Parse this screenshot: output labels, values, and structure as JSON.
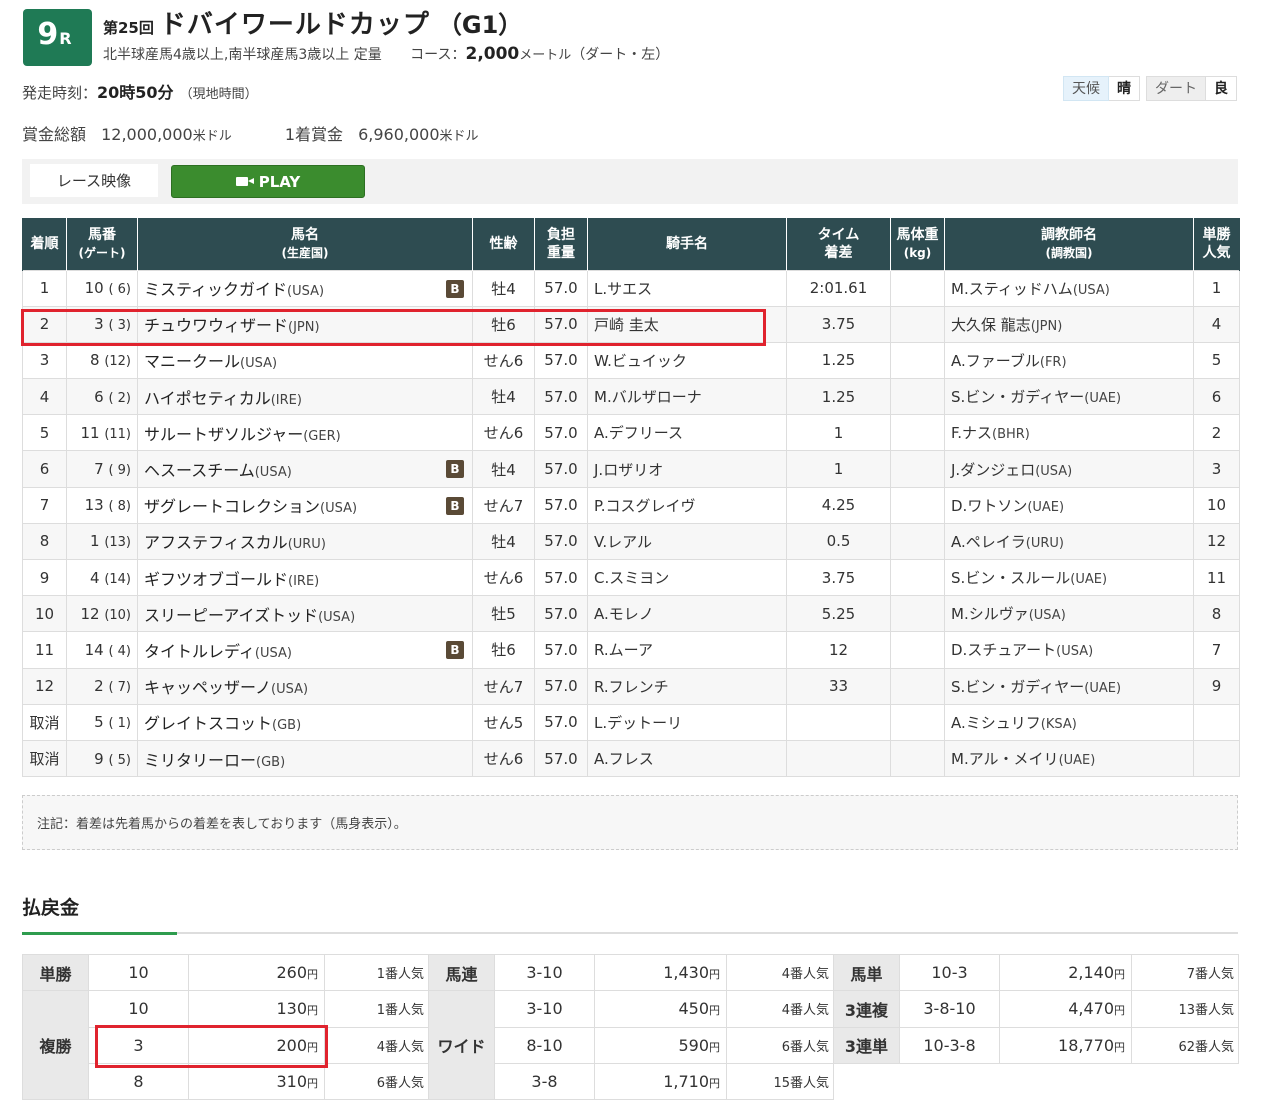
{
  "race": {
    "number": "9",
    "r_label": "R",
    "round": "第25回",
    "name": "ドバイワールドカップ",
    "grade": "（G1）",
    "conditions": "北半球産馬4歳以上,南半球産馬3歳以上 定量",
    "course_label": "コース：",
    "distance": "2,000",
    "distance_unit": "メートル",
    "surface": "（ダート・左）",
    "start_label": "発走時刻：",
    "start_time": "20時50分",
    "start_local": "（現地時間）"
  },
  "conditions_box": {
    "weather_label": "天候",
    "weather": "晴",
    "track_label": "ダート",
    "track": "良"
  },
  "prize": {
    "total_label": "賞金総額",
    "total": "12,000,000",
    "total_unit": "米ドル",
    "first_label": "1着賞金",
    "first": "6,960,000",
    "first_unit": "米ドル"
  },
  "video": {
    "tab_label": "レース映像",
    "play_label": "PLAY"
  },
  "results_header": {
    "pos": "着順",
    "num": "馬番",
    "num_sub": "(ゲート)",
    "horse": "馬名",
    "horse_sub": "(生産国)",
    "sexage": "性齢",
    "weight": "負担",
    "weight_sub": "重量",
    "jockey": "騎手名",
    "time": "タイム",
    "time_sub": "着差",
    "bodyweight": "馬体重",
    "bodyweight_sub": "(kg)",
    "trainer": "調教師名",
    "trainer_sub": "(調教国)",
    "fav": "単勝",
    "fav_sub": "人気"
  },
  "results": [
    {
      "pos": "1",
      "num": "10",
      "gate": "( 6)",
      "horse": "ミスティックガイド",
      "country": "(USA)",
      "blinker": "B",
      "sexage": "牡4",
      "weight": "57.0",
      "jockey": "L.サエス",
      "time": "2:01.61",
      "body": "",
      "trainer": "M.スティッドハム",
      "trainer_country": "(USA)",
      "fav": "1"
    },
    {
      "pos": "2",
      "num": "3",
      "gate": "( 3)",
      "horse": "チュウワウィザード",
      "country": "(JPN)",
      "blinker": "",
      "sexage": "牡6",
      "weight": "57.0",
      "jockey": "戸崎 圭太",
      "time": "3.75",
      "body": "",
      "trainer": "大久保 龍志",
      "trainer_country": "(JPN)",
      "fav": "4"
    },
    {
      "pos": "3",
      "num": "8",
      "gate": "(12)",
      "horse": "マニークール",
      "country": "(USA)",
      "blinker": "",
      "sexage": "せん6",
      "weight": "57.0",
      "jockey": "W.ビュイック",
      "time": "1.25",
      "body": "",
      "trainer": "A.ファーブル",
      "trainer_country": "(FR)",
      "fav": "5"
    },
    {
      "pos": "4",
      "num": "6",
      "gate": "( 2)",
      "horse": "ハイポセティカル",
      "country": "(IRE)",
      "blinker": "",
      "sexage": "牡4",
      "weight": "57.0",
      "jockey": "M.バルザローナ",
      "time": "1.25",
      "body": "",
      "trainer": "S.ビン・ガディヤー",
      "trainer_country": "(UAE)",
      "fav": "6"
    },
    {
      "pos": "5",
      "num": "11",
      "gate": "(11)",
      "horse": "サルートザソルジャー",
      "country": "(GER)",
      "blinker": "",
      "sexage": "せん6",
      "weight": "57.0",
      "jockey": "A.デフリース",
      "time": "1",
      "body": "",
      "trainer": "F.ナス",
      "trainer_country": "(BHR)",
      "fav": "2"
    },
    {
      "pos": "6",
      "num": "7",
      "gate": "( 9)",
      "horse": "ヘスースチーム",
      "country": "(USA)",
      "blinker": "B",
      "sexage": "牡4",
      "weight": "57.0",
      "jockey": "J.ロザリオ",
      "time": "1",
      "body": "",
      "trainer": "J.ダンジェロ",
      "trainer_country": "(USA)",
      "fav": "3"
    },
    {
      "pos": "7",
      "num": "13",
      "gate": "( 8)",
      "horse": "ザグレートコレクション",
      "country": "(USA)",
      "blinker": "B",
      "sexage": "せん7",
      "weight": "57.0",
      "jockey": "P.コスグレイヴ",
      "time": "4.25",
      "body": "",
      "trainer": "D.ワトソン",
      "trainer_country": "(UAE)",
      "fav": "10"
    },
    {
      "pos": "8",
      "num": "1",
      "gate": "(13)",
      "horse": "アフステフィスカル",
      "country": "(URU)",
      "blinker": "",
      "sexage": "牡4",
      "weight": "57.0",
      "jockey": "V.レアル",
      "time": "0.5",
      "body": "",
      "trainer": "A.ペレイラ",
      "trainer_country": "(URU)",
      "fav": "12"
    },
    {
      "pos": "9",
      "num": "4",
      "gate": "(14)",
      "horse": "ギフツオブゴールド",
      "country": "(IRE)",
      "blinker": "",
      "sexage": "せん6",
      "weight": "57.0",
      "jockey": "C.スミヨン",
      "time": "3.75",
      "body": "",
      "trainer": "S.ビン・スルール",
      "trainer_country": "(UAE)",
      "fav": "11"
    },
    {
      "pos": "10",
      "num": "12",
      "gate": "(10)",
      "horse": "スリーピーアイズトッド",
      "country": "(USA)",
      "blinker": "",
      "sexage": "牡5",
      "weight": "57.0",
      "jockey": "A.モレノ",
      "time": "5.25",
      "body": "",
      "trainer": "M.シルヴァ",
      "trainer_country": "(USA)",
      "fav": "8"
    },
    {
      "pos": "11",
      "num": "14",
      "gate": "( 4)",
      "horse": "タイトルレディ",
      "country": "(USA)",
      "blinker": "B",
      "sexage": "牡6",
      "weight": "57.0",
      "jockey": "R.ムーア",
      "time": "12",
      "body": "",
      "trainer": "D.スチュアート",
      "trainer_country": "(USA)",
      "fav": "7"
    },
    {
      "pos": "12",
      "num": "2",
      "gate": "( 7)",
      "horse": "キャッペッザーノ",
      "country": "(USA)",
      "blinker": "",
      "sexage": "せん7",
      "weight": "57.0",
      "jockey": "R.フレンチ",
      "time": "33",
      "body": "",
      "trainer": "S.ビン・ガディヤー",
      "trainer_country": "(UAE)",
      "fav": "9"
    },
    {
      "pos": "取消",
      "num": "5",
      "gate": "( 1)",
      "horse": "グレイトスコット",
      "country": "(GB)",
      "blinker": "",
      "sexage": "せん5",
      "weight": "57.0",
      "jockey": "L.デットーリ",
      "time": "",
      "body": "",
      "trainer": "A.ミシュリフ",
      "trainer_country": "(KSA)",
      "fav": ""
    },
    {
      "pos": "取消",
      "num": "9",
      "gate": "( 5)",
      "horse": "ミリタリーロー",
      "country": "(GB)",
      "blinker": "",
      "sexage": "せん6",
      "weight": "57.0",
      "jockey": "A.フレス",
      "time": "",
      "body": "",
      "trainer": "M.アル・メイリ",
      "trainer_country": "(UAE)",
      "fav": ""
    }
  ],
  "note": "注記：着差は先着馬からの着差を表しております（馬身表示）。",
  "payout": {
    "title": "払戻金",
    "yen_unit": "円",
    "win": {
      "label": "単勝",
      "rows": [
        {
          "num": "10",
          "amount": "260",
          "pop": "1番人気"
        }
      ]
    },
    "place": {
      "label": "複勝",
      "rows": [
        {
          "num": "10",
          "amount": "130",
          "pop": "1番人気"
        },
        {
          "num": "3",
          "amount": "200",
          "pop": "4番人気"
        },
        {
          "num": "8",
          "amount": "310",
          "pop": "6番人気"
        }
      ]
    },
    "quinella": {
      "label": "馬連",
      "rows": [
        {
          "num": "3-10",
          "amount": "1,430",
          "pop": "4番人気"
        }
      ]
    },
    "wide": {
      "label": "ワイド",
      "rows": [
        {
          "num": "3-10",
          "amount": "450",
          "pop": "4番人気"
        },
        {
          "num": "8-10",
          "amount": "590",
          "pop": "6番人気"
        },
        {
          "num": "3-8",
          "amount": "1,710",
          "pop": "15番人気"
        }
      ]
    },
    "exacta": {
      "label": "馬単",
      "rows": [
        {
          "num": "10-3",
          "amount": "2,140",
          "pop": "7番人気"
        }
      ]
    },
    "trio": {
      "label": "3連複",
      "rows": [
        {
          "num": "3-8-10",
          "amount": "4,470",
          "pop": "13番人気"
        }
      ]
    },
    "trifecta": {
      "label": "3連単",
      "rows": [
        {
          "num": "10-3-8",
          "amount": "18,770",
          "pop": "62番人気"
        }
      ]
    }
  },
  "colors": {
    "race_badge": "#1f7a55",
    "table_header": "#2e4c51",
    "play_button": "#3b8c2e",
    "highlight": "#e0232e"
  }
}
